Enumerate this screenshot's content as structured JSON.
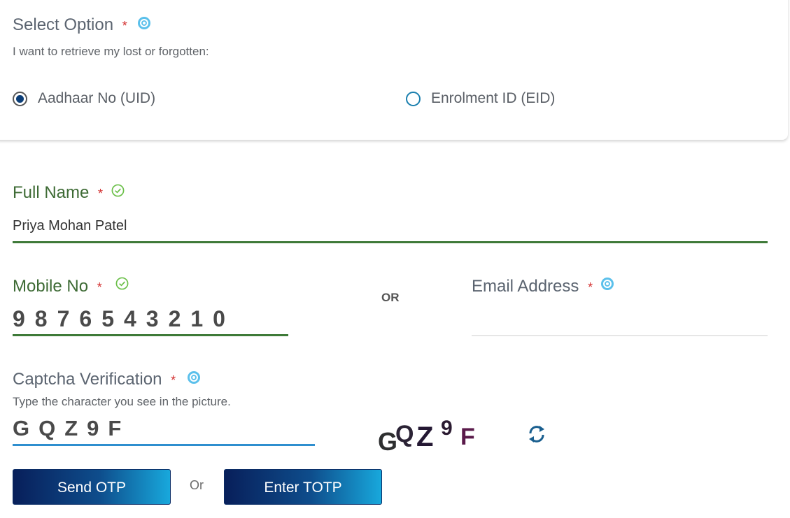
{
  "select_option": {
    "title": "Select Option",
    "required_mark": "*",
    "subtitle": "I want to retrieve my lost or forgotten:",
    "options": [
      {
        "label": "Aadhaar No (UID)",
        "checked": true
      },
      {
        "label": "Enrolment ID (EID)",
        "checked": false
      }
    ]
  },
  "full_name": {
    "label": "Full Name",
    "required_mark": "*",
    "value": "Priya Mohan Patel"
  },
  "mobile": {
    "label": "Mobile No",
    "required_mark": "*",
    "value": "9876543210"
  },
  "or_separator": "OR",
  "email": {
    "label": "Email Address",
    "required_mark": "*",
    "value": ""
  },
  "captcha": {
    "label": "Captcha Verification",
    "required_mark": "*",
    "hint": "Type the character you see in the picture.",
    "value": "GQZ9F",
    "image_text": "GQZ9F"
  },
  "actions": {
    "send_otp": "Send OTP",
    "or": "Or",
    "enter_totp": "Enter TOTP"
  },
  "colors": {
    "valid_green": "#3e7a38",
    "focus_blue": "#2f8fcf",
    "button_dark": "#081f5a",
    "button_light": "#18a8dc",
    "required_red": "#d32f2f"
  }
}
